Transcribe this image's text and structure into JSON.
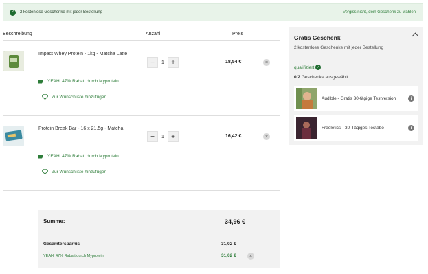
{
  "banner": {
    "message": "2 kostenlose Geschenke mit jeder Bestellung",
    "link": "Vergiss nicht, dein Geschenk zu wählen"
  },
  "columns": {
    "description": "Beschreibung",
    "quantity": "Anzahl",
    "price": "Preis"
  },
  "items": [
    {
      "name": "Impact Whey Protein - 1kg - Matcha Latte",
      "quantity": "1",
      "price": "18,54 €",
      "promo": "YEAH! 47% Rabatt durch Myprotein",
      "wishlist": "Zur Wunschliste hinzufügen"
    },
    {
      "name": "Protein Break Bar - 16 x 21.5g - Matcha",
      "quantity": "1",
      "price": "16,42 €",
      "promo": "YEAH! 47% Rabatt durch Myprotein",
      "wishlist": "Zur Wunschliste hinzufügen"
    }
  ],
  "summary": {
    "total_label": "Summe:",
    "total_value": "34,96 €",
    "savings_label": "Gesamtersparnis",
    "savings_value": "31,02 €",
    "promo_label": "YEAH! 47% Rabatt durch Myprotein",
    "promo_value": "31,02 €"
  },
  "gift_panel": {
    "title": "Gratis Geschenk",
    "subtitle": "2 kostenlose Geschenke mit jeder Bestellung",
    "qualified": "qualifiziert",
    "selected_count": "0/2",
    "selected_text": "Geschenke ausgewählt",
    "gifts": [
      {
        "name": "Audible - Gratis 30-tägige Testversion"
      },
      {
        "name": "Freeletics - 30-Tägiges Testabo"
      }
    ]
  },
  "colors": {
    "accent": "#2e7d3a",
    "banner_bg": "#e8f3e9",
    "panel_bg": "#f2f2f2"
  }
}
